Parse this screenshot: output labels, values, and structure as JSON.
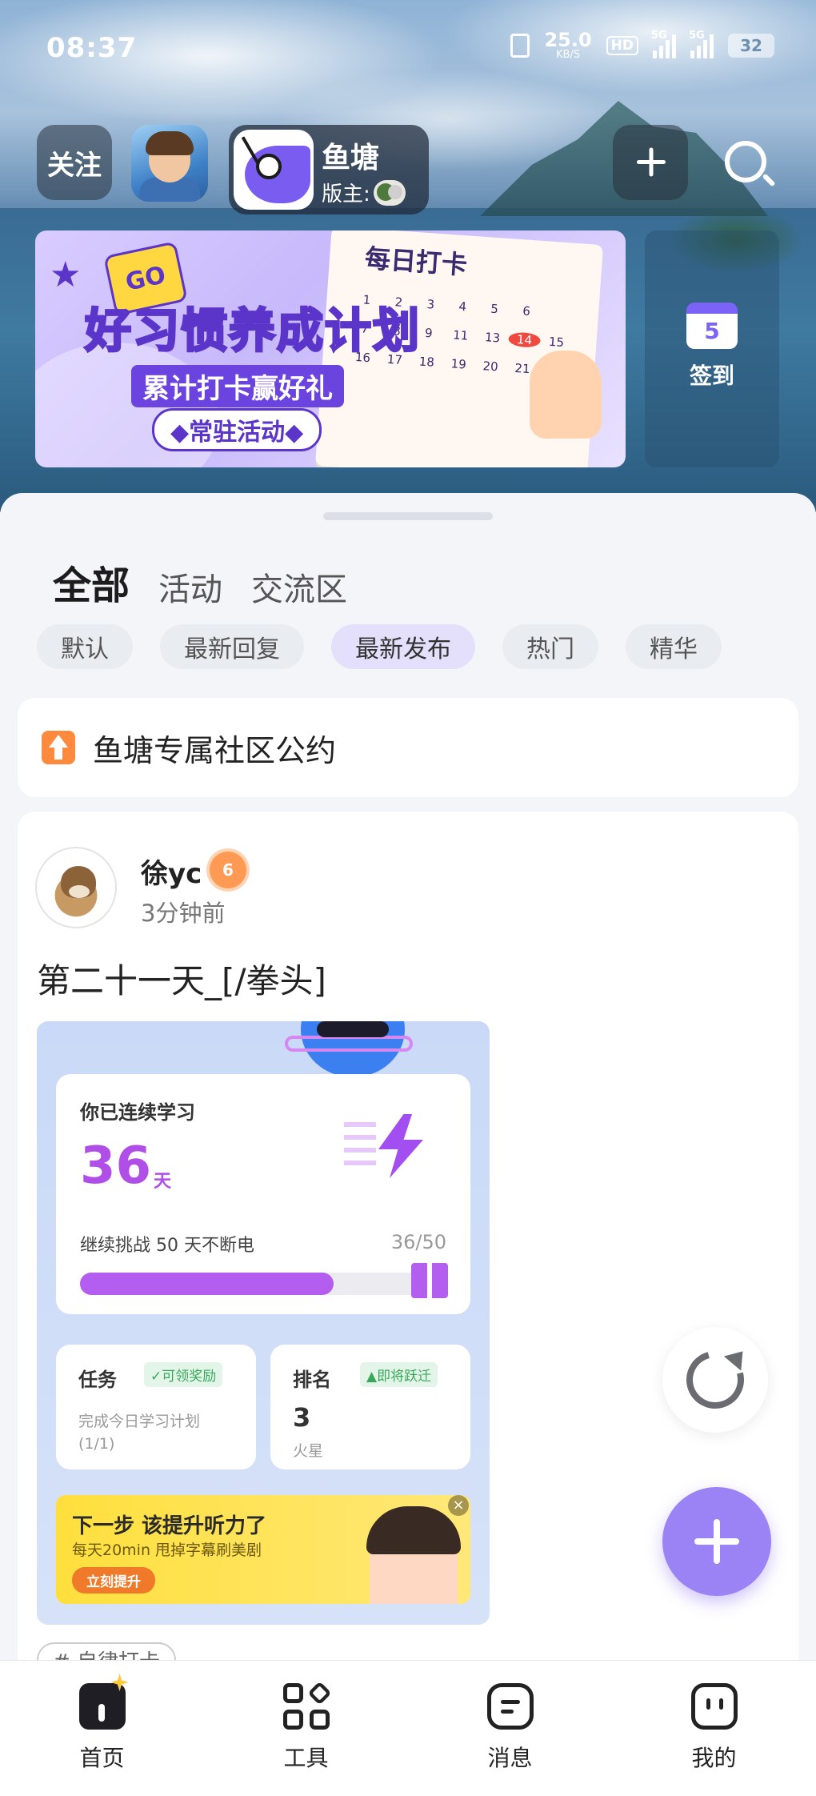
{
  "status_bar": {
    "time": "08:37",
    "net_speed": "25.0",
    "net_unit": "KB/S",
    "hd": "HD",
    "sig1_label": "5G",
    "sig2_label": "5G",
    "battery": "32"
  },
  "top_nav": {
    "follow_label": "关注",
    "group_name": "鱼塘",
    "moderator_label": "版主:"
  },
  "banner": {
    "title": "好习惯养成计划",
    "subtitle": "累计打卡赢好礼",
    "tag": "◆常驻活动◆",
    "go": "GO",
    "calendar_title": "每日打卡",
    "calendar_days": [
      "1",
      "2",
      "3",
      "4",
      "5",
      "6",
      "",
      "7",
      "8",
      "9",
      "11",
      "13",
      "14",
      "15",
      "16",
      "17",
      "18",
      "19",
      "20",
      "21",
      ""
    ],
    "calendar_highlight": "14"
  },
  "signin": {
    "day": "5",
    "label": "签到"
  },
  "tabs": [
    {
      "label": "全部",
      "active": true
    },
    {
      "label": "活动",
      "active": false
    },
    {
      "label": "交流区",
      "active": false
    }
  ],
  "filters": [
    {
      "label": "默认",
      "active": false
    },
    {
      "label": "最新回复",
      "active": false
    },
    {
      "label": "最新发布",
      "active": true
    },
    {
      "label": "热门",
      "active": false
    },
    {
      "label": "精华",
      "active": false
    }
  ],
  "notice": {
    "text": "鱼塘专属社区公约"
  },
  "post": {
    "username": "徐yc",
    "level": "6",
    "time": "3分钟前",
    "title": "第二十一天_[/拳头]",
    "image": {
      "streak_heading": "你已连续学习",
      "streak_days": "36",
      "streak_unit": "天",
      "challenge": "继续挑战 50 天不断电",
      "ratio": "36/50",
      "progress": 0.72,
      "task_heading": "任务",
      "task_badge": "✓可领奖励",
      "task_desc_1": "完成今日学习计划",
      "task_desc_2": "(1/1)",
      "rank_heading": "排名",
      "rank_badge": "▲即将跃迁",
      "rank_value": "3",
      "rank_sub": "火星",
      "ad_title": "下一步 该提升听力了",
      "ad_sub": "每天20min 甩掉字幕刷美剧",
      "ad_button": "立刻提升",
      "ad_close": "×"
    },
    "topic_tag": "# 自律打卡"
  },
  "bottom_nav": [
    {
      "label": "首页",
      "icon": "home-icon"
    },
    {
      "label": "工具",
      "icon": "tools-icon"
    },
    {
      "label": "消息",
      "icon": "message-icon"
    },
    {
      "label": "我的",
      "icon": "profile-icon"
    }
  ],
  "colors": {
    "accent": "#9b82f5",
    "streak_purple": "#b04ee8",
    "notice_orange": "#ff8a3d"
  }
}
